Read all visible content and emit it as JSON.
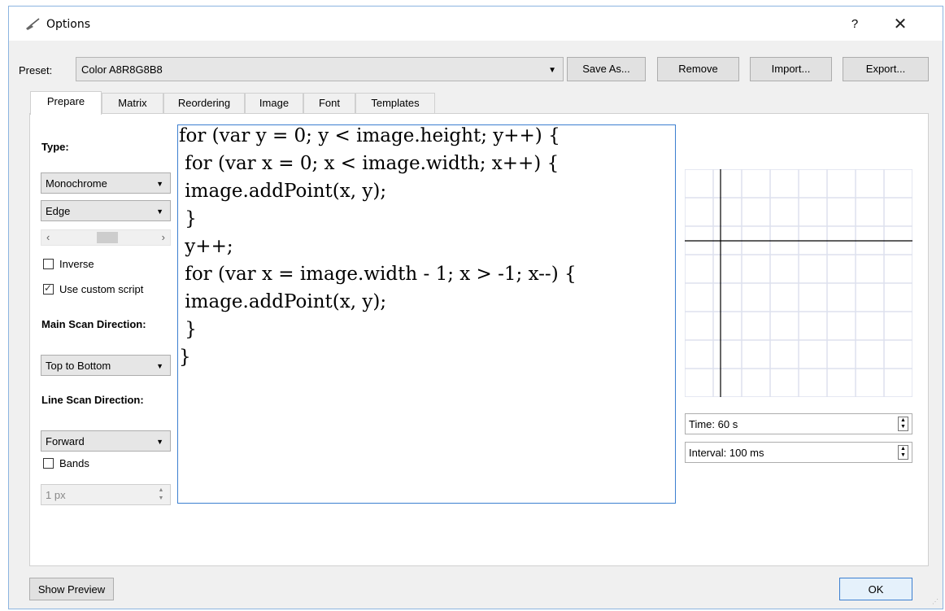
{
  "window": {
    "title": "Options",
    "help_glyph": "?",
    "close_glyph": "✕"
  },
  "preset": {
    "label": "Preset:",
    "value": "Color A8R8G8B8",
    "save_as": "Save As...",
    "remove": "Remove",
    "import": "Import...",
    "export": "Export..."
  },
  "tabs": [
    {
      "label": "Prepare"
    },
    {
      "label": "Matrix"
    },
    {
      "label": "Reordering"
    },
    {
      "label": "Image"
    },
    {
      "label": "Font"
    },
    {
      "label": "Templates"
    }
  ],
  "prepare": {
    "type_label": "Type:",
    "type_value": "Monochrome",
    "mode_value": "Edge",
    "inverse_label": "Inverse",
    "inverse_checked": false,
    "custom_script_label": "Use custom script",
    "custom_script_checked": true,
    "main_scan_label": "Main Scan Direction:",
    "main_scan_value": "Top to Bottom",
    "line_scan_label": "Line Scan Direction:",
    "line_scan_value": "Forward",
    "bands_label": "Bands",
    "bands_checked": false,
    "band_width_value": "1 px"
  },
  "script": {
    "lines": [
      "for (var y = 0; y < image.height; y++) {",
      " for (var x = 0; x < image.width; x++) {",
      " image.addPoint(x, y);",
      " }",
      " y++;",
      " for (var x = image.width - 1; x > -1; x--) {",
      " image.addPoint(x, y);",
      " }",
      "}"
    ]
  },
  "preview": {
    "time_value": "Time: 60 s",
    "interval_value": "Interval: 100 ms"
  },
  "footer": {
    "show_preview": "Show Preview",
    "ok": "OK"
  },
  "icons": {
    "app": "broom-icon",
    "dropdown": "chevron-down-icon",
    "spin": "spin-arrows-icon"
  },
  "colors": {
    "accent": "#3c7fd0",
    "grid": "#dde1ee"
  }
}
